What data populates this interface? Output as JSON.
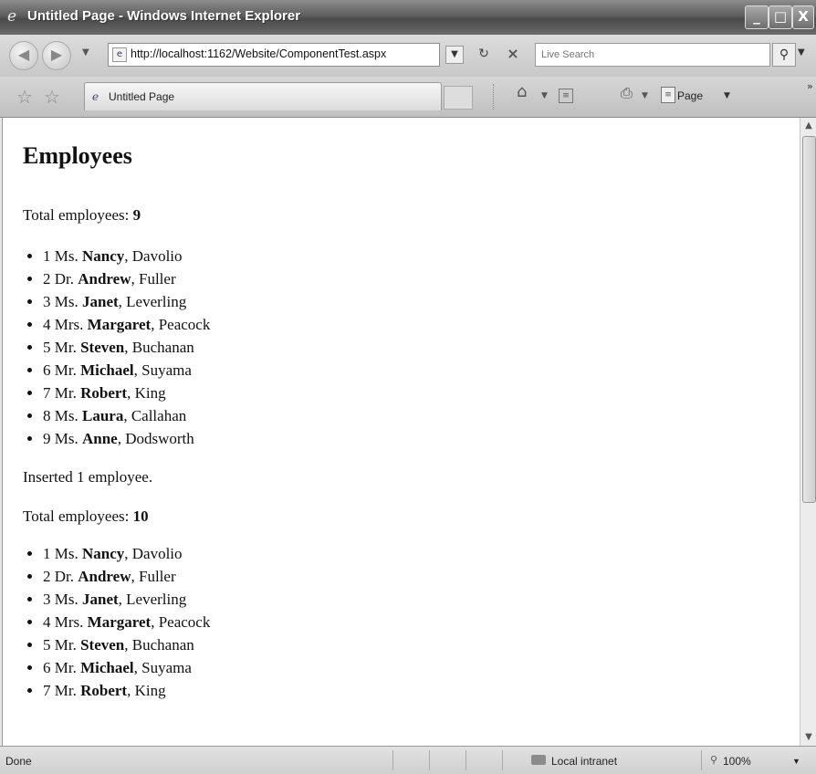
{
  "window": {
    "title": "Untitled Page - Windows Internet Explorer",
    "controls": {
      "minimize": "_",
      "maximize": "□",
      "close": "X"
    }
  },
  "address_bar": {
    "url": "http://localhost:1162/Website/ComponentTest.aspx"
  },
  "search": {
    "placeholder": "Live Search"
  },
  "tab": {
    "label": "Untitled Page"
  },
  "command_bar": {
    "page_label": "Page"
  },
  "page": {
    "heading": "Employees",
    "first_block": {
      "total_label": "Total employees: ",
      "total_value": "9",
      "employees": [
        {
          "id": "1",
          "title": "Ms.",
          "first": "Nancy",
          "last": "Davolio"
        },
        {
          "id": "2",
          "title": "Dr.",
          "first": "Andrew",
          "last": "Fuller"
        },
        {
          "id": "3",
          "title": "Ms.",
          "first": "Janet",
          "last": "Leverling"
        },
        {
          "id": "4",
          "title": "Mrs.",
          "first": "Margaret",
          "last": "Peacock"
        },
        {
          "id": "5",
          "title": "Mr.",
          "first": "Steven",
          "last": "Buchanan"
        },
        {
          "id": "6",
          "title": "Mr.",
          "first": "Michael",
          "last": "Suyama"
        },
        {
          "id": "7",
          "title": "Mr.",
          "first": "Robert",
          "last": "King"
        },
        {
          "id": "8",
          "title": "Ms.",
          "first": "Laura",
          "last": "Callahan"
        },
        {
          "id": "9",
          "title": "Ms.",
          "first": "Anne",
          "last": "Dodsworth"
        }
      ]
    },
    "inserted_message": "Inserted 1 employee.",
    "second_block": {
      "total_label": "Total employees: ",
      "total_value": "10",
      "employees": [
        {
          "id": "1",
          "title": "Ms.",
          "first": "Nancy",
          "last": "Davolio"
        },
        {
          "id": "2",
          "title": "Dr.",
          "first": "Andrew",
          "last": "Fuller"
        },
        {
          "id": "3",
          "title": "Ms.",
          "first": "Janet",
          "last": "Leverling"
        },
        {
          "id": "4",
          "title": "Mrs.",
          "first": "Margaret",
          "last": "Peacock"
        },
        {
          "id": "5",
          "title": "Mr.",
          "first": "Steven",
          "last": "Buchanan"
        },
        {
          "id": "6",
          "title": "Mr.",
          "first": "Michael",
          "last": "Suyama"
        },
        {
          "id": "7",
          "title": "Mr.",
          "first": "Robert",
          "last": "King"
        }
      ]
    }
  },
  "status_bar": {
    "status": "Done",
    "zone": "Local intranet",
    "zoom": "100%"
  },
  "icons": {
    "ie": "ie-icon",
    "back": "back-arrow-icon",
    "forward": "forward-arrow-icon",
    "refresh": "refresh-icon",
    "stop": "stop-icon",
    "search": "search-icon",
    "favorites": "favorites-star-icon",
    "add_favorite": "add-favorite-icon",
    "home": "home-icon",
    "feeds": "feeds-icon",
    "print": "print-icon",
    "page": "page-icon",
    "zone": "intranet-zone-icon",
    "zoom": "zoom-icon"
  }
}
